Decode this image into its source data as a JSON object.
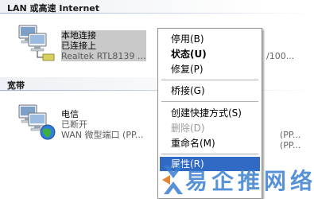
{
  "sections": {
    "lan_header": "LAN 或高速 Internet",
    "broadband_header": "宽带"
  },
  "lan_connection": {
    "name": "本地连接",
    "status": "已连接上",
    "device": "Realtek RTL8139 …",
    "right_detail": "/100..."
  },
  "broadband_connection": {
    "name": "电信",
    "status": "已断开",
    "device": "WAN 微型端口 (PP...",
    "right_detail_1": "(PP...",
    "right_detail_2": "(PP..."
  },
  "context_menu": {
    "items": [
      {
        "label": "停用(B)"
      },
      {
        "label": "状态(U)"
      },
      {
        "label": "修复(P)"
      },
      {
        "label": "桥接(G)"
      },
      {
        "label": "创建快捷方式(S)"
      },
      {
        "label": "删除(D)"
      },
      {
        "label": "重命名(M)"
      },
      {
        "label": "属性(R)"
      }
    ]
  },
  "watermark": {
    "text": "易企推网络"
  },
  "colors": {
    "selection_gray": "#c9c9c9",
    "menu_highlight": "#316ac5",
    "watermark_blue": "#3a7fd0"
  }
}
